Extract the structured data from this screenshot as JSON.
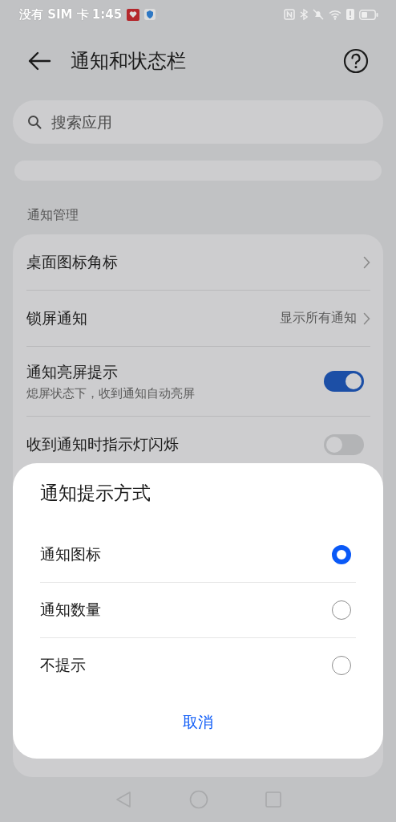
{
  "status_bar": {
    "carrier": "没有 SIM 卡",
    "time": "1:45"
  },
  "header": {
    "title": "通知和状态栏"
  },
  "search": {
    "placeholder": "搜索应用"
  },
  "section": {
    "label": "通知管理"
  },
  "settings": [
    {
      "kind": "link",
      "title": "桌面图标角标"
    },
    {
      "kind": "link",
      "title": "锁屏通知",
      "value": "显示所有通知"
    },
    {
      "kind": "toggle",
      "title": "通知亮屏提示",
      "subtitle": "熄屏状态下，收到通知自动亮屏",
      "on": true
    },
    {
      "kind": "toggle",
      "title": "收到通知时指示灯闪烁",
      "on": false
    }
  ],
  "dialog": {
    "title": "通知提示方式",
    "options": [
      {
        "label": "通知图标",
        "selected": true
      },
      {
        "label": "通知数量",
        "selected": false
      },
      {
        "label": "不提示",
        "selected": false
      }
    ],
    "cancel": "取消"
  }
}
